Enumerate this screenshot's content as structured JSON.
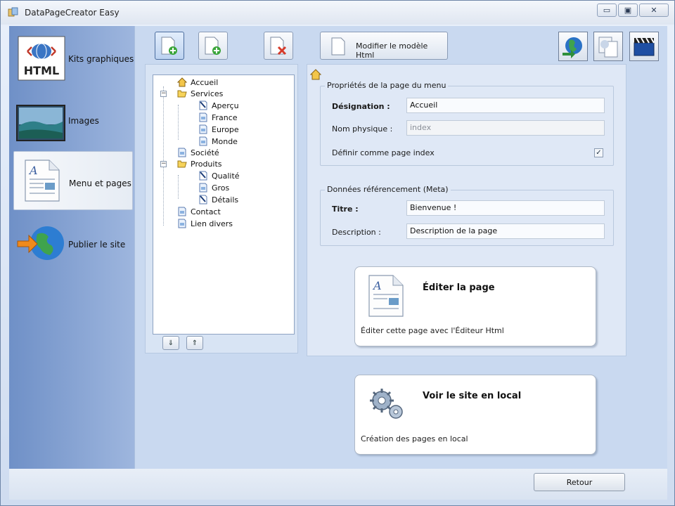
{
  "window": {
    "title": "DataPageCreator Easy",
    "controls": {
      "minimize": "▭",
      "maximize": "▣",
      "close": "✕"
    }
  },
  "sidebar": {
    "items": [
      {
        "label": "Kits graphiques",
        "icon": "html-kit-icon",
        "active": false
      },
      {
        "label": "Images",
        "icon": "landscape-image-icon",
        "active": false
      },
      {
        "label": "Menu et pages",
        "icon": "document-page-icon",
        "active": true
      },
      {
        "label": "Publier le site",
        "icon": "globe-arrow-icon",
        "active": false
      }
    ]
  },
  "toolbar": {
    "buttons": [
      {
        "icon": "add-page-icon"
      },
      {
        "icon": "add-subpage-icon"
      },
      {
        "icon": "delete-page-icon"
      }
    ],
    "modify_label": "Modifier le modèle Html",
    "right_buttons": [
      {
        "icon": "globe-publish-icon"
      },
      {
        "icon": "copy-pages-icon"
      },
      {
        "icon": "clapperboard-icon"
      }
    ]
  },
  "tree": {
    "nodes": [
      {
        "label": "Accueil",
        "type": "home",
        "level": 0
      },
      {
        "label": "Services",
        "type": "folder",
        "level": 0,
        "expanded": true
      },
      {
        "label": "Aperçu",
        "type": "page-edit",
        "level": 1
      },
      {
        "label": "France",
        "type": "page",
        "level": 1
      },
      {
        "label": "Europe",
        "type": "page",
        "level": 1
      },
      {
        "label": "Monde",
        "type": "page",
        "level": 1
      },
      {
        "label": "Société",
        "type": "page",
        "level": 0
      },
      {
        "label": "Produits",
        "type": "folder",
        "level": 0,
        "expanded": true
      },
      {
        "label": "Qualité",
        "type": "page-edit",
        "level": 1
      },
      {
        "label": "Gros",
        "type": "page",
        "level": 1
      },
      {
        "label": "Détails",
        "type": "page-edit",
        "level": 1
      },
      {
        "label": "Contact",
        "type": "page",
        "level": 0
      },
      {
        "label": "Lien divers",
        "type": "page",
        "level": 0
      }
    ],
    "down_label": "⇓",
    "up_label": "⇑"
  },
  "props": {
    "page_group_title": "Propriétés de la page du menu",
    "designation_label": "Désignation :",
    "designation_value": "Accueil",
    "nom_physique_label": "Nom physique :",
    "nom_physique_value": "index",
    "index_label": "Définir comme page index",
    "index_checked": "✓",
    "meta_group_title": "Données référencement (Meta)",
    "titre_label": "Titre :",
    "titre_value": "Bienvenue !",
    "description_label": "Description :",
    "description_value": "Description de la page"
  },
  "cards": {
    "edit": {
      "title": "Éditer la page",
      "desc": "Éditer cette page avec l'Éditeur Html",
      "icon": "document-page-icon"
    },
    "local": {
      "title": "Voir le site en local",
      "desc": "Création des pages en local",
      "icon": "gears-icon"
    }
  },
  "footer": {
    "retour_label": "Retour"
  },
  "colors": {
    "accent": "#6f90c7",
    "panel": "#c9d9f0"
  }
}
